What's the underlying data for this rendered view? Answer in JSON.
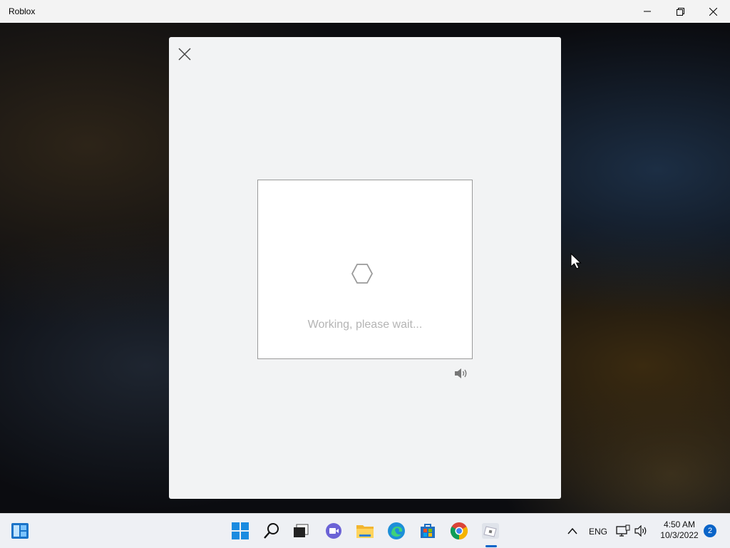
{
  "window": {
    "title": "Roblox"
  },
  "modal": {
    "loading_text": "Working, please wait..."
  },
  "taskbar": {
    "apps": [
      "start-icon",
      "search-icon",
      "task-view-icon",
      "chat-icon",
      "file-explorer-icon",
      "edge-icon",
      "store-icon",
      "chrome-icon",
      "roblox-icon"
    ],
    "language": "ENG",
    "time": "4:50 AM",
    "date": "10/3/2022",
    "notification_count": "2"
  },
  "colors": {
    "accent": "#0a64c8",
    "modal_bg": "#f2f3f4",
    "loading_text": "#b4b4b4"
  }
}
